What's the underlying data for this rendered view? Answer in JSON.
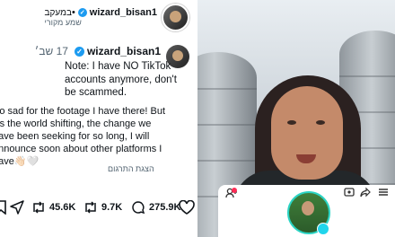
{
  "header": {
    "username": "wizard_bisan1",
    "follow_label": "במעקב",
    "subtitle": "שמע מקורי"
  },
  "tweet": {
    "username": "wizard_bisan1",
    "date": "17 שב׳",
    "note": "Note: I have NO TikTok accounts anymore, don't be scammed.",
    "body": "So sad for the footage I have there! But it's the world shifting, the change we have been seeking for so long, I will announce soon about other platforms I have👋🏻🤍",
    "translate_label": "הצגת התרגום"
  },
  "actions": {
    "likes": "45.6K",
    "retweets": "9.7K",
    "replies": "275.9K"
  },
  "colors": {
    "verified": "#1d9bf0",
    "text": "#0f1419",
    "muted": "#536471",
    "live_badge": "#fe2c55",
    "avatar_ring": "#2bd4c4"
  },
  "video_overlay": {
    "icons": [
      "add-user-icon",
      "live-icon",
      "share-icon",
      "menu-icon"
    ]
  }
}
